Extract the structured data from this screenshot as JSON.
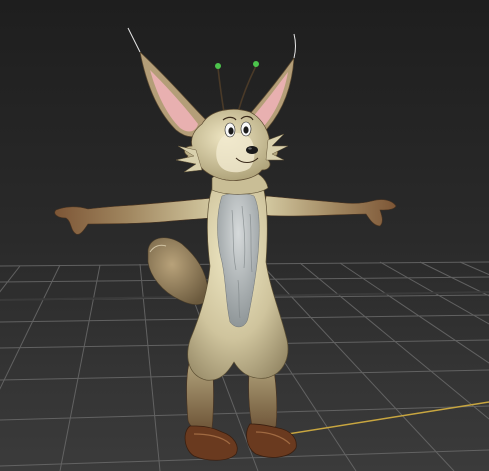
{
  "viewport": {
    "background_top": "#1d1d1d",
    "background_bottom": "#3a3a3a",
    "grid_color": "#6b6b6b",
    "grid_axis_color": "#3a3a3a",
    "horizon_line_color": "#c8a640"
  },
  "character": {
    "fur_light": "#d9d3ae",
    "fur_mid": "#b0a580",
    "fur_dark": "#7c6d4c",
    "fur_brown": "#8a6a48",
    "chest_grey": "#b9bfc2",
    "boot_brown": "#6a3a1f",
    "inner_ear_pink": "#e8b0b0",
    "antenna_tip_green": "#4cc44c",
    "whisker_color": "#e8e8e8",
    "tail_color": "#8a7656"
  }
}
